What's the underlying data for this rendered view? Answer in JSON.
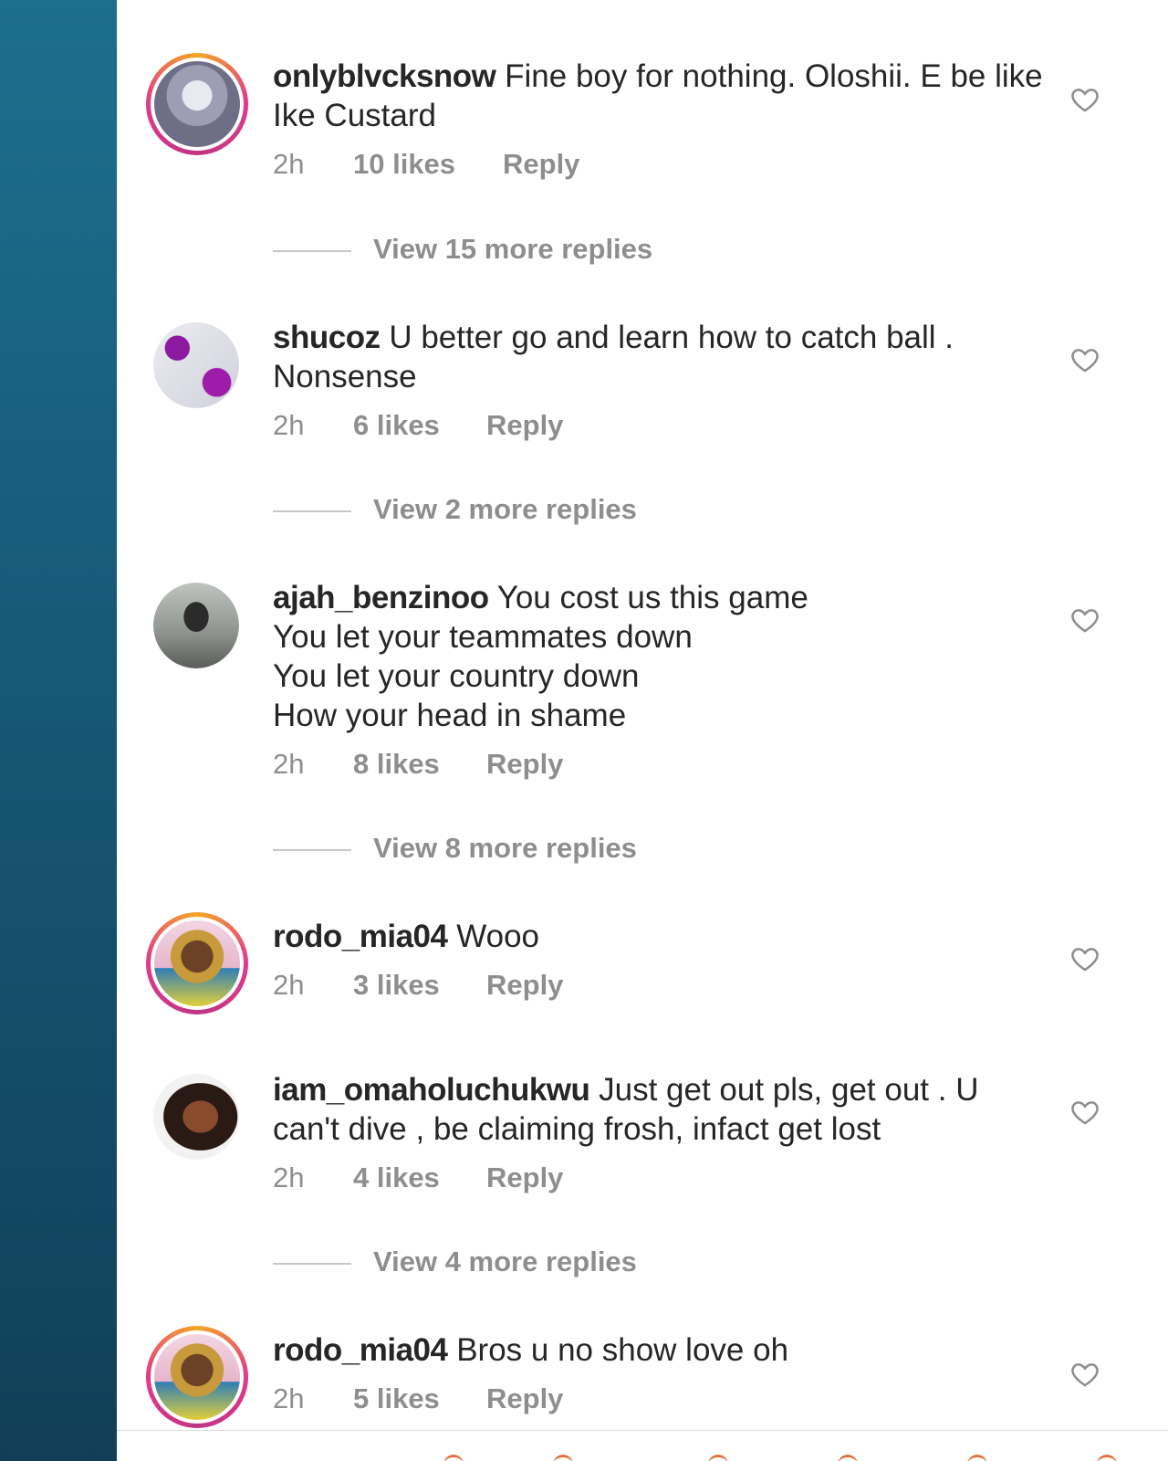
{
  "comments": [
    {
      "username": "onlyblvcksnow",
      "text": "Fine boy for nothing. Oloshii. E be like\nIke Custard",
      "time": "2h",
      "likes": "10 likes",
      "reply": "Reply",
      "view_more": "View 15 more replies",
      "story_ring": true
    },
    {
      "username": "shucoz",
      "text": "U better go and learn how to catch ball .\nNonsense",
      "time": "2h",
      "likes": "6 likes",
      "reply": "Reply",
      "view_more": "View 2 more replies",
      "story_ring": false
    },
    {
      "username": "ajah_benzinoo",
      "text": "You cost us this game\nYou let your teammates down\nYou let your country down\nHow your head in shame",
      "time": "2h",
      "likes": "8 likes",
      "reply": "Reply",
      "view_more": "View 8 more replies",
      "story_ring": false
    },
    {
      "username": "rodo_mia04",
      "text": "Wooo",
      "time": "2h",
      "likes": "3 likes",
      "reply": "Reply",
      "story_ring": true
    },
    {
      "username": "iam_omaholuchukwu",
      "text": "Just get out pls, get out . U\ncan't dive , be claiming frosh, infact get lost",
      "time": "2h",
      "likes": "4 likes",
      "reply": "Reply",
      "view_more": "View 4 more replies",
      "story_ring": false
    },
    {
      "username": "rodo_mia04",
      "text": "Bros u no show love oh",
      "time": "2h",
      "likes": "5 likes",
      "reply": "Reply",
      "story_ring": true
    }
  ],
  "icons": {
    "like": "heart-outline-icon"
  },
  "colors": {
    "text_primary": "#262626",
    "text_secondary": "#8e8e8e",
    "story_ring_start": "#f5a623",
    "story_ring_end": "#c13584",
    "side_background": "#185d7c"
  }
}
